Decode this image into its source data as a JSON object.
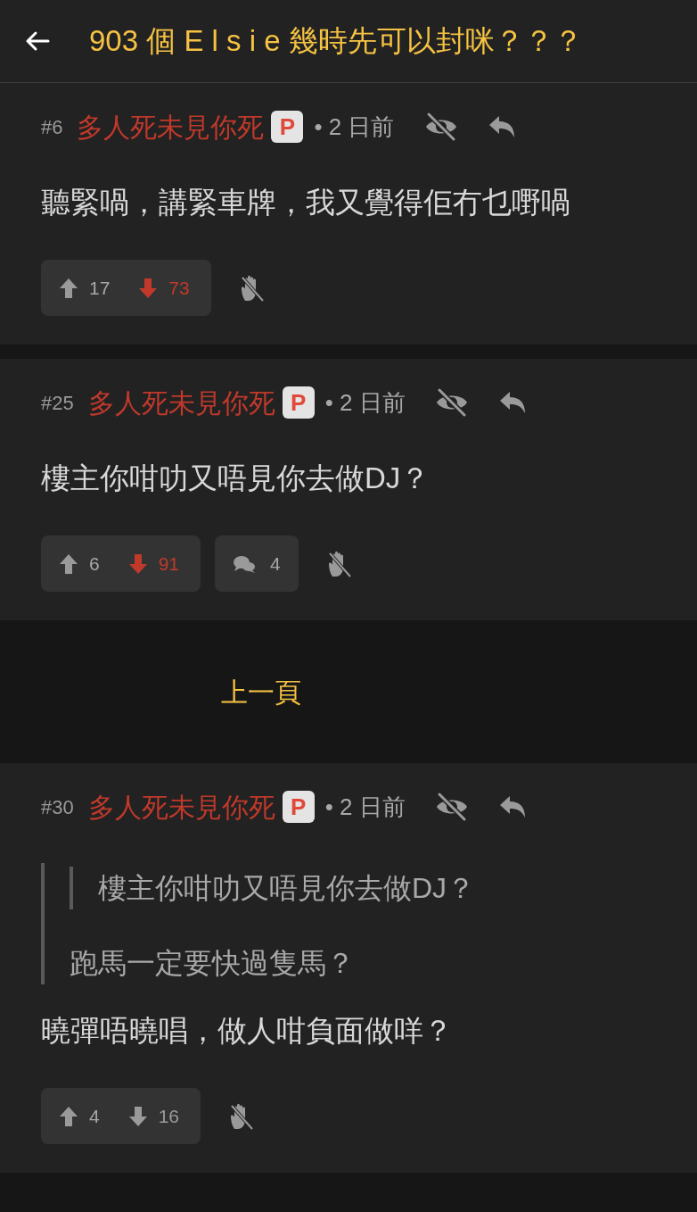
{
  "header": {
    "title": "903 個 E l s i e 幾時先可以封咪？？？"
  },
  "posts": [
    {
      "number": "#6",
      "author": "多人死未見你死",
      "badge": "P",
      "time": "• 2 日前",
      "body": "聽緊喎，講緊車牌，我又覺得佢冇乜嘢喎",
      "upvotes": "17",
      "downvotes": "73",
      "down_highlighted": true
    },
    {
      "number": "#25",
      "author": "多人死未見你死",
      "badge": "P",
      "time": "• 2 日前",
      "body": "樓主你咁叻又唔見你去做DJ？",
      "upvotes": "6",
      "downvotes": "91",
      "down_highlighted": true,
      "replies": "4"
    }
  ],
  "pagination": {
    "previous": "上一頁"
  },
  "posts_after": [
    {
      "number": "#30",
      "author": "多人死未見你死",
      "badge": "P",
      "time": "• 2 日前",
      "quote": {
        "children": [
          {
            "text": "樓主你咁叻又唔見你去做DJ？"
          }
        ],
        "text": "跑馬一定要快過隻馬？"
      },
      "body": "曉彈唔曉唱，做人咁負面做咩？",
      "upvotes": "4",
      "downvotes": "16",
      "down_highlighted": false
    }
  ]
}
